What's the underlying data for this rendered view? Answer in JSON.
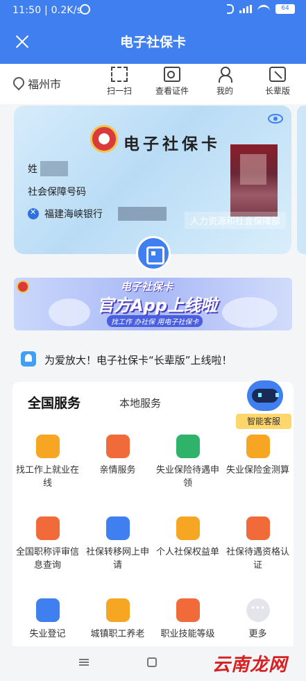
{
  "status_bar": {
    "time": "11:50 | 0.2K/s",
    "battery": "64"
  },
  "header": {
    "title": "电子社保卡",
    "close_icon": "close-icon"
  },
  "location": {
    "city": "福州市"
  },
  "tools": [
    {
      "label": "扫一扫",
      "icon": "scan-icon"
    },
    {
      "label": "查看证件",
      "icon": "id-card-icon"
    },
    {
      "label": "我的",
      "icon": "user-icon"
    },
    {
      "label": "长辈版",
      "icon": "elder-mode-icon"
    }
  ],
  "card": {
    "title": "电子社保卡",
    "name_label": "姓",
    "ssn_label": "社会保障号码",
    "bank_name": "福建海峡银行",
    "issuer": "人力资源和社会保障部"
  },
  "banner": {
    "line1": "电子社保卡",
    "line2": "官方App上线啦",
    "line3": "找工作 办社保 用电子社保卡"
  },
  "notice": {
    "text": "为爱放大！电子社保卡“长辈版”上线啦！"
  },
  "services": {
    "tabs": [
      {
        "label": "全国服务",
        "active": true
      },
      {
        "label": "本地服务",
        "active": false
      }
    ],
    "assistant_label": "智能客服",
    "items": [
      {
        "label": "找工作上就业在线",
        "icon": "job-search-icon",
        "color": "#f6a623"
      },
      {
        "label": "亲情服务",
        "icon": "family-heart-icon",
        "color": "#f06a3a"
      },
      {
        "label": "失业保险待遇申领",
        "icon": "unemployment-benefit-icon",
        "color": "#2fb36a"
      },
      {
        "label": "失业保险金测算",
        "icon": "calculator-person-icon",
        "color": "#f6a623"
      },
      {
        "label": "全国职称评审信息查询",
        "icon": "title-review-icon",
        "color": "#f06a3a"
      },
      {
        "label": "社保转移网上申请",
        "icon": "transfer-icon",
        "color": "#3f7ff0"
      },
      {
        "label": "个人社保权益单",
        "icon": "rights-document-icon",
        "color": "#f6a623"
      },
      {
        "label": "社保待遇资格认证",
        "icon": "qualification-icon",
        "color": "#f06a3a"
      },
      {
        "label": "失业登记",
        "icon": "unemployment-register-icon",
        "color": "#3f7ff0"
      },
      {
        "label": "城镇职工养老",
        "icon": "pension-icon",
        "color": "#f6a623"
      },
      {
        "label": "职业技能等级",
        "icon": "skill-level-icon",
        "color": "#f06a3a"
      },
      {
        "label": "更多",
        "icon": "more-icon",
        "color": "#e3e5ea"
      }
    ]
  },
  "watermark": "云南龙网"
}
